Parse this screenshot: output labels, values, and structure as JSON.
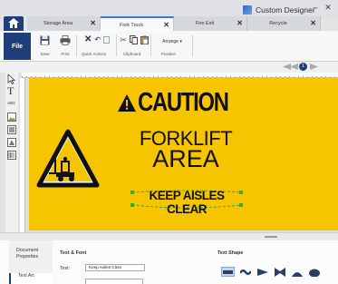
{
  "app": {
    "title": "Custom Designer"
  },
  "tabs": [
    {
      "label": "Storage Area",
      "close": "✕"
    },
    {
      "label": "Fork Truck",
      "close": "✕"
    },
    {
      "label": "Fire Exit",
      "close": "✕"
    },
    {
      "label": "Recycle",
      "close": "✕"
    }
  ],
  "ribbon": {
    "file": "File",
    "save": "Save",
    "print": "Print",
    "quick_actions": "Quick Actions",
    "clipboard": "Clipboard",
    "arrange": "Arrange ▾",
    "position": "Position"
  },
  "zoom": {
    "page": "1"
  },
  "label": {
    "caution": "CAUTION",
    "line1": "FORKLIFT",
    "line2": "AREA",
    "line3": "KEEP AISLES CLEAR"
  },
  "colors": {
    "label_bg": "#f7c500",
    "accent": "#1f3f7a"
  },
  "panel": {
    "side_items": [
      "Document Properties",
      "Text Art"
    ],
    "text_font_title": "Text & Font",
    "text_label": "Text:",
    "text_value": "Keep Aisles Clear",
    "text_shape_title": "Text Shape"
  }
}
